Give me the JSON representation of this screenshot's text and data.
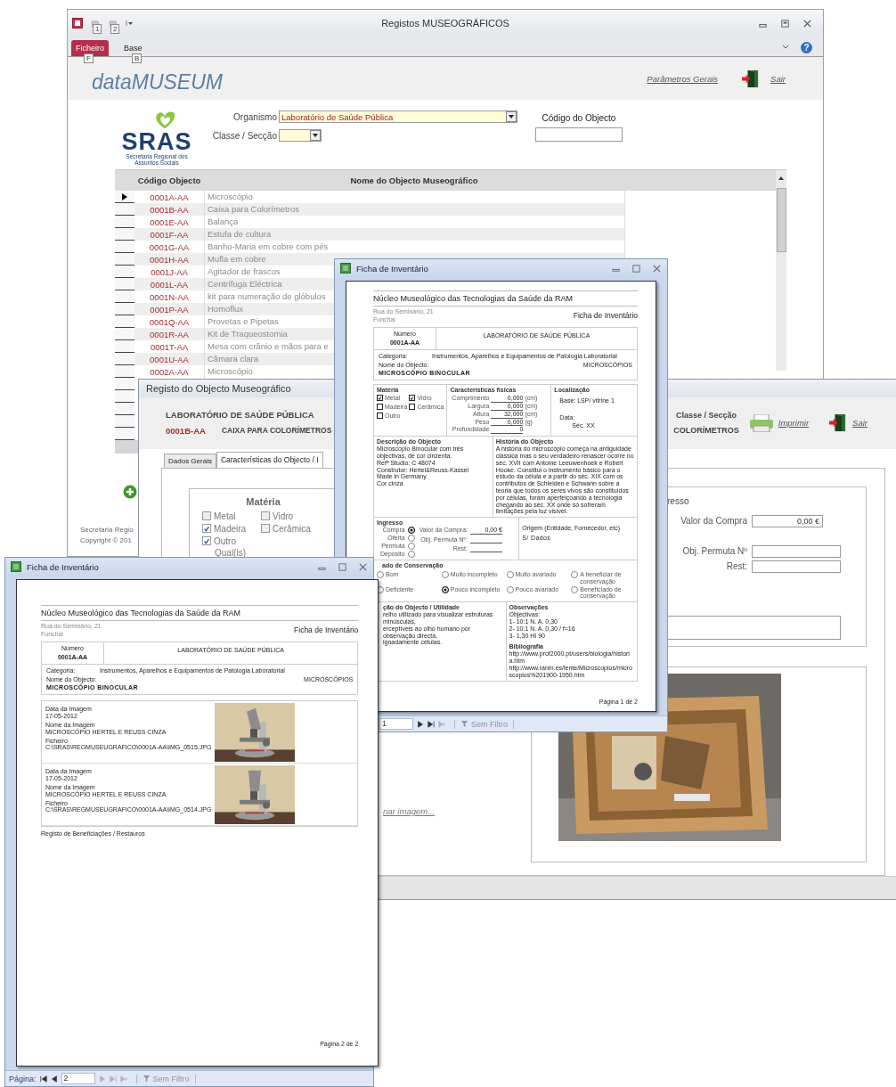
{
  "main_window": {
    "title": "Registos MUSEOGRÁFICOS",
    "quick_access": [
      "1",
      "2"
    ],
    "ribbon_tabs": [
      {
        "label": "Ficheiro",
        "key": "F",
        "selected": true
      },
      {
        "label": "Base",
        "key": "B",
        "selected": false
      }
    ],
    "help": "?",
    "app_title": "dataMUSEUM",
    "header_links": [
      "Parâmetros Gerais",
      "Sair"
    ],
    "logo": {
      "text": "SRAS",
      "subtitle": "Secretaria Regional dos Assuntos Sociais"
    },
    "organismo": {
      "label": "Organismo",
      "value": "Laboratório de Saúde Pública"
    },
    "classe": {
      "label": "Classe / Secção"
    },
    "codigo": {
      "label": "Código do Objecto"
    },
    "table": {
      "columns": [
        "Código Objecto",
        "Nome do Objecto Museográfico"
      ],
      "rows": [
        {
          "code": "0001A-AA",
          "name": "Microscópio",
          "selected": true
        },
        {
          "code": "0001B-AA",
          "name": "Caixa para Colorímetros",
          "selected": false
        },
        {
          "code": "0001E-AA",
          "name": "Balança",
          "selected": false
        },
        {
          "code": "0001F-AA",
          "name": "Estufa de cultura",
          "selected": false
        },
        {
          "code": "0001G-AA",
          "name": "Banho-Maria em cobre com pés",
          "selected": false
        },
        {
          "code": "0001H-AA",
          "name": "Mufla em cobre",
          "selected": false
        },
        {
          "code": "0001J-AA",
          "name": "Agitador de frascos",
          "selected": false
        },
        {
          "code": "0001L-AA",
          "name": "Centrífuga Eléctrica",
          "selected": false
        },
        {
          "code": "0001N-AA",
          "name": "kit para numeração de glóbulos",
          "selected": false
        },
        {
          "code": "0001P-AA",
          "name": "Homoflux",
          "selected": false
        },
        {
          "code": "0001Q-AA",
          "name": "Provetas e Pipetas",
          "selected": false
        },
        {
          "code": "0001R-AA",
          "name": "Kit de Traqueostomia",
          "selected": false
        },
        {
          "code": "0001T-AA",
          "name": "Mesa com crânio e mãos para e",
          "selected": false
        },
        {
          "code": "0001U-AA",
          "name": "Câmara clara",
          "selected": false
        },
        {
          "code": "0002A-AA",
          "name": "Microscópio",
          "selected": false
        }
      ]
    },
    "footer": [
      "Secretaria Regio",
      "Copyright © 201"
    ]
  },
  "record_window": {
    "title": "Registo do Objecto Museográfico",
    "organismo": "LABORATÓRIO DE SAÚDE PÚBLICA",
    "code": "0001B-AA",
    "name": "CAIXA PARA COLORÍMETROS",
    "classe_label": "Classe / Secção",
    "classe_value": "COLORÍMETROS",
    "actions": [
      "Imprimir",
      "Sair"
    ],
    "tabs": [
      {
        "label": "Dados Gerais",
        "selected": false
      },
      {
        "label": "Características do Objecto / I",
        "selected": true
      }
    ],
    "materia": {
      "title": "Matéria",
      "options": [
        {
          "label": "Metal",
          "checked": false
        },
        {
          "label": "Vidro",
          "checked": false
        },
        {
          "label": "Madeira",
          "checked": true
        },
        {
          "label": "Cerâmica",
          "checked": false
        },
        {
          "label": "Outro",
          "checked": true
        }
      ],
      "other_label": "Qual(is)"
    },
    "ingresso": {
      "title": "resso",
      "valor_label": "Valor da Compra",
      "valor": "0,00 €",
      "permuta_label": "Obj. Permuta Nº",
      "rest_label": "Rest:"
    },
    "image_link": "nar imagem..."
  },
  "inventory_windows": [
    {
      "title": "Ficha de Inventário",
      "report": {
        "org": "Núcleo Museológico das Tecnologias da Saúde da RAM",
        "address": [
          "Rua do Seminário, 21",
          "Funchal"
        ],
        "heading": "Ficha de Inventário",
        "number_label": "Número",
        "number": "0001A-AA",
        "lab": "LABORATÓRIO DE SAÚDE PÚBLICA",
        "category_label": "Categoria:",
        "category": "Instrumentos, Aparelhos e Equipamentos de Patologia Laboratorial",
        "object_label": "Nome do Objecto:",
        "object": "MICROSCÓPIO BINOCULAR",
        "class": "MICROSCÓPIOS",
        "details": {
          "materia": {
            "title": "Matéria",
            "options": [
              {
                "label": "Metal",
                "checked": true
              },
              {
                "label": "Vidro",
                "checked": true
              },
              {
                "label": "Madeira",
                "checked": false
              },
              {
                "label": "Cerâmica",
                "checked": false
              },
              {
                "label": "Outro",
                "checked": false
              }
            ]
          },
          "physical": {
            "title": "Características físicas",
            "rows": [
              {
                "label": "Comprimento",
                "value": "0,000",
                "unit": "(cm)"
              },
              {
                "label": "Largura",
                "value": "0,000",
                "unit": "(cm)"
              },
              {
                "label": "Altura",
                "value": "32,000",
                "unit": "(cm)"
              },
              {
                "label": "Peso",
                "value": "0,000",
                "unit": "(g)"
              },
              {
                "label": "Profundidade",
                "value": "0"
              }
            ]
          },
          "location": {
            "title": "Localização",
            "base": "Base: LSP/ vitrine 1",
            "date_label": "Data:",
            "date": "Séc. XX"
          },
          "description": {
            "title": "Descrição do Objecto",
            "lines": [
              "Microscópio Binocular com três objectivas, de cor cinzenta.",
              "Refª Studio: C 48074",
              "Construtor: Hertel&Reuss-Kassel",
              "Made in Germany",
              "Cor cinza"
            ]
          },
          "history": {
            "title": "História do Objecto",
            "text": "A história do microscópio começa na antiguidade clássica mas o seu verdadeiro renascer ocorre no séc. XVII com Antoine Leeuwenhoek e Robert Hooke. Constitui o instrumento básico para o estudo da célula e a partir do séc. XIX com os contributos de Schleiden e Schwann sobre a teoria que todos os seres vivos são constituídos por células, foram aperfeiçoando a tecnologia chegando ao séc. XX onde só sofreram limitações pela luz visível."
          },
          "ingresso": {
            "title": "Ingresso",
            "options": [
              {
                "label": "Compra",
                "selected": true
              },
              {
                "label": "Oferta",
                "selected": false
              },
              {
                "label": "Permuta",
                "selected": false
              },
              {
                "label": "Depósito",
                "selected": false
              }
            ],
            "fields": [
              {
                "label": "Valor da Compra:",
                "value": "0,00 €"
              },
              {
                "label": "Obj. Permuta Nº:"
              },
              {
                "label": "Rest:"
              }
            ],
            "origin_label": "Origem (Entidade, Fornecedor, etc)",
            "origin": "S/ Dados"
          },
          "conservation": {
            "title": "ado de Conservação",
            "options": [
              {
                "label": "Bom",
                "selected": false
              },
              {
                "label": "Deficiente",
                "selected": false
              },
              {
                "label": "Muito incompleto",
                "selected": false
              },
              {
                "label": "Pouco incompleto",
                "selected": true
              },
              {
                "label": "Muito avariado",
                "selected": false
              },
              {
                "label": "Pouco avariado",
                "selected": false
              },
              {
                "label": "A beneficiar de conservação",
                "selected": false
              },
              {
                "label": "Beneficiado de conservação",
                "selected": false
              }
            ]
          },
          "utility": {
            "title": "ção do Objecto / Utilidade",
            "lines": [
              "relho utilizado para visualizar estruturas minúsculas,",
              "erceptíveis ao olho humano por observação directa,",
              "ignadamente células."
            ]
          },
          "observations": {
            "title": "Observações",
            "lines": [
              "Objectivas:",
              "1- 10:1 N. A. 0,30",
              "2- 10:1 N. A. 0,30 / f=16",
              "3- 1,30 HI 90"
            ],
            "biblio_title": "Bibliografia",
            "biblio": [
              "http://www.prof2000.pt/users/biologia/historia.htm",
              "http://www.ranm.es/lente/Microscopios/microscopios%201900-1950.htm"
            ]
          }
        },
        "page_label": "Página 1 de 2"
      },
      "nav": {
        "page": "1",
        "buttons": [
          {
            "kind": "next",
            "disabled": false
          },
          {
            "kind": "last",
            "disabled": false
          },
          {
            "kind": "new",
            "disabled": true
          }
        ],
        "filter": "Sem Filtro"
      }
    },
    {
      "title": "Ficha de Inventário",
      "report": {
        "org": "Núcleo Museológico das Tecnologias da Saúde da RAM",
        "address": [
          "Rua do Seminário, 21",
          "Funchal"
        ],
        "heading": "Ficha de Inventário",
        "number_label": "Número",
        "number": "0001A-AA",
        "lab": "LABORATÓRIO DE SAÚDE PÚBLICA",
        "category_label": "Categoria:",
        "category": "Instrumentos, Aparelhos e Equipamentos de Patologia Laboratorial",
        "object_label": "Nome do Objecto:",
        "object": "MICROSCÓPIO BINOCULAR",
        "class": "MICROSCÓPIOS",
        "images": [
          {
            "date_label": "Data da Imagem",
            "date": "17-05-2012",
            "name_label": "Nome da Imagem",
            "name": "MICROSCÓPIO  HERTEL E REUSS CINZA",
            "file_label": "Ficheiro",
            "file": "C:\\SRAS\\REGMUSEUGRAFICO\\0001A-AA\\IMG_0515.JPG"
          },
          {
            "date_label": "Data da Imagem",
            "date": "17-05-2012",
            "name_label": "Nome da Imagem",
            "name": "MICROSCÓPIO HERTEL E REUSS CINZA",
            "file_label": "Ficheiro",
            "file": "C:\\SRAS\\REGMUSEUGRAFICO\\0001A-AA\\IMG_0514.JPG"
          }
        ],
        "restauros": "Registo de Beneficiações / Restauros",
        "page_label": "Página 2 de 2"
      },
      "nav": {
        "page_label": "Página:",
        "page": "2",
        "buttons": [
          {
            "kind": "first",
            "disabled": false
          },
          {
            "kind": "prev",
            "disabled": false
          },
          {
            "kind": "next",
            "disabled": true
          },
          {
            "kind": "last",
            "disabled": true
          },
          {
            "kind": "new",
            "disabled": true
          }
        ],
        "filter": "Sem Filtro"
      }
    }
  ]
}
